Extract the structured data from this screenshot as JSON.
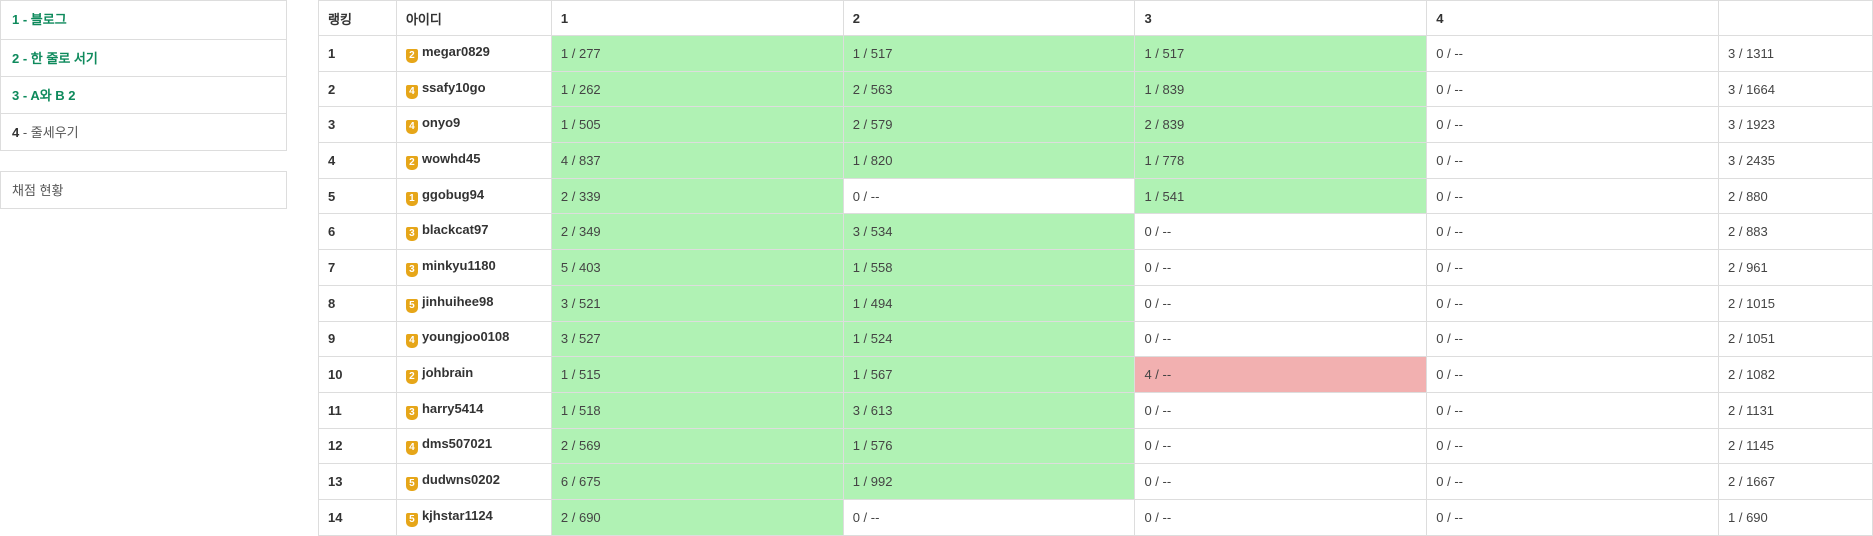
{
  "sidebar": {
    "problems": [
      {
        "num": "1",
        "sep": " - ",
        "title": "블로그",
        "solved": true
      },
      {
        "num": "2",
        "sep": " - ",
        "title": "한 줄로 서기",
        "solved": true
      },
      {
        "num": "3",
        "sep": " - ",
        "title": "A와 B 2",
        "solved": true
      },
      {
        "num": "4",
        "sep": " - ",
        "title": "줄세우기",
        "solved": false
      }
    ],
    "status_link": "채점 현황"
  },
  "table": {
    "headers": [
      "랭킹",
      "아이디",
      "1",
      "2",
      "3",
      "4",
      ""
    ],
    "rows": [
      {
        "rank": "1",
        "tier": "2",
        "id": "megar0829",
        "p": [
          "1 / 277",
          "1 / 517",
          "1 / 517",
          "0 / --"
        ],
        "status": [
          "ac",
          "ac",
          "ac",
          ""
        ],
        "total": "3 / 1311"
      },
      {
        "rank": "2",
        "tier": "4",
        "id": "ssafy10go",
        "p": [
          "1 / 262",
          "2 / 563",
          "1 / 839",
          "0 / --"
        ],
        "status": [
          "ac",
          "ac",
          "ac",
          ""
        ],
        "total": "3 / 1664"
      },
      {
        "rank": "3",
        "tier": "4",
        "id": "onyo9",
        "p": [
          "1 / 505",
          "2 / 579",
          "2 / 839",
          "0 / --"
        ],
        "status": [
          "ac",
          "ac",
          "ac",
          ""
        ],
        "total": "3 / 1923"
      },
      {
        "rank": "4",
        "tier": "2",
        "id": "wowhd45",
        "p": [
          "4 / 837",
          "1 / 820",
          "1 / 778",
          "0 / --"
        ],
        "status": [
          "ac",
          "ac",
          "ac",
          ""
        ],
        "total": "3 / 2435"
      },
      {
        "rank": "5",
        "tier": "1",
        "id": "ggobug94",
        "p": [
          "2 / 339",
          "0 / --",
          "1 / 541",
          "0 / --"
        ],
        "status": [
          "ac",
          "",
          "ac",
          ""
        ],
        "total": "2 / 880"
      },
      {
        "rank": "6",
        "tier": "3",
        "id": "blackcat97",
        "p": [
          "2 / 349",
          "3 / 534",
          "0 / --",
          "0 / --"
        ],
        "status": [
          "ac",
          "ac",
          "",
          ""
        ],
        "total": "2 / 883"
      },
      {
        "rank": "7",
        "tier": "3",
        "id": "minkyu1180",
        "p": [
          "5 / 403",
          "1 / 558",
          "0 / --",
          "0 / --"
        ],
        "status": [
          "ac",
          "ac",
          "",
          ""
        ],
        "total": "2 / 961"
      },
      {
        "rank": "8",
        "tier": "5",
        "id": "jinhuihee98",
        "p": [
          "3 / 521",
          "1 / 494",
          "0 / --",
          "0 / --"
        ],
        "status": [
          "ac",
          "ac",
          "",
          ""
        ],
        "total": "2 / 1015"
      },
      {
        "rank": "9",
        "tier": "4",
        "id": "youngjoo0108",
        "p": [
          "3 / 527",
          "1 / 524",
          "0 / --",
          "0 / --"
        ],
        "status": [
          "ac",
          "ac",
          "",
          ""
        ],
        "total": "2 / 1051"
      },
      {
        "rank": "10",
        "tier": "2",
        "id": "johbrain",
        "p": [
          "1 / 515",
          "1 / 567",
          "4 / --",
          "0 / --"
        ],
        "status": [
          "ac",
          "ac",
          "wa",
          ""
        ],
        "total": "2 / 1082"
      },
      {
        "rank": "11",
        "tier": "3",
        "id": "harry5414",
        "p": [
          "1 / 518",
          "3 / 613",
          "0 / --",
          "0 / --"
        ],
        "status": [
          "ac",
          "ac",
          "",
          ""
        ],
        "total": "2 / 1131"
      },
      {
        "rank": "12",
        "tier": "4",
        "id": "dms507021",
        "p": [
          "2 / 569",
          "1 / 576",
          "0 / --",
          "0 / --"
        ],
        "status": [
          "ac",
          "ac",
          "",
          ""
        ],
        "total": "2 / 1145"
      },
      {
        "rank": "13",
        "tier": "5",
        "id": "dudwns0202",
        "p": [
          "6 / 675",
          "1 / 992",
          "0 / --",
          "0 / --"
        ],
        "status": [
          "ac",
          "ac",
          "",
          ""
        ],
        "total": "2 / 1667"
      },
      {
        "rank": "14",
        "tier": "5",
        "id": "kjhstar1124",
        "p": [
          "2 / 690",
          "0 / --",
          "0 / --",
          "0 / --"
        ],
        "status": [
          "ac",
          "",
          "",
          ""
        ],
        "total": "1 / 690"
      }
    ]
  },
  "colors": {
    "accepted": "#b0f2b4",
    "wrong": "#f2b0b0",
    "solved_text": "#0e8a5c",
    "tier_badge": "#e6a619"
  },
  "icons": {
    "tier_badge": "tier-badge-icon"
  }
}
